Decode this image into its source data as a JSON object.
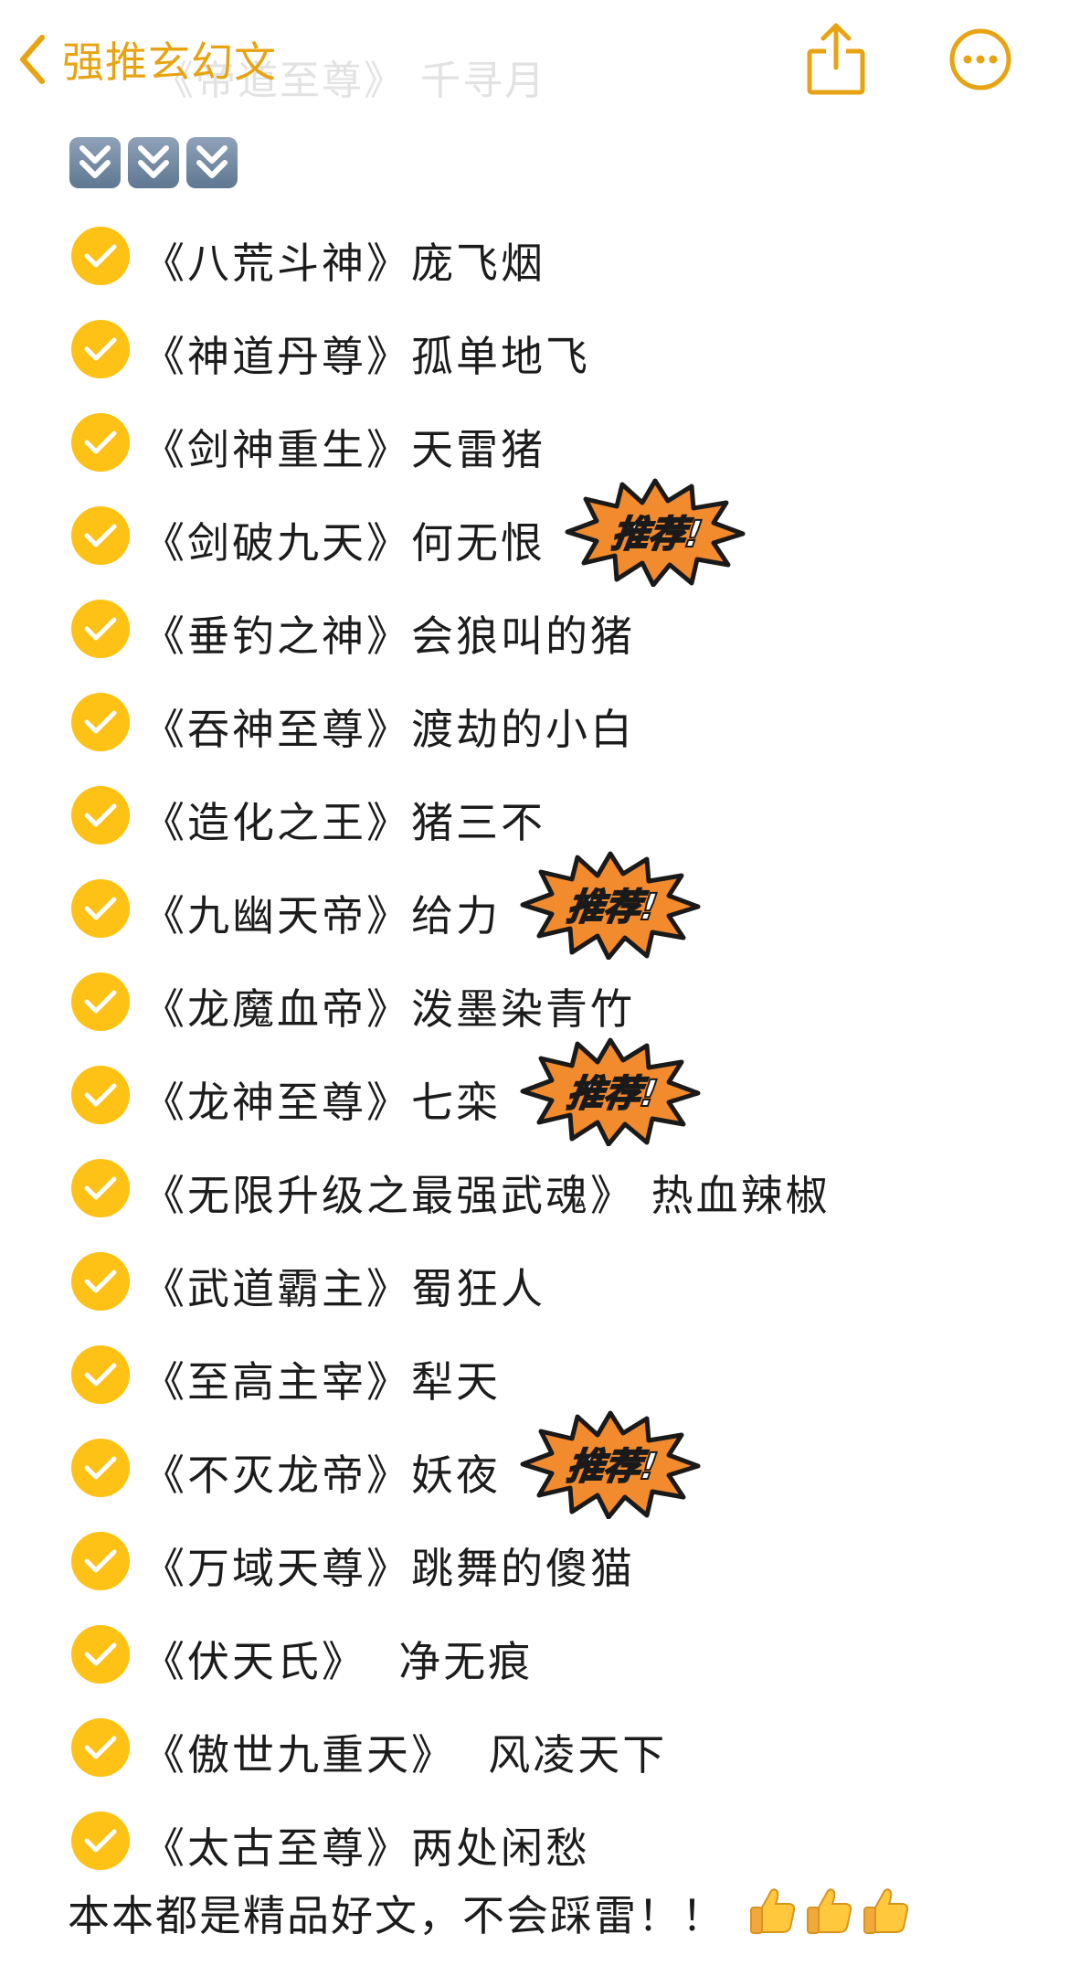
{
  "nav": {
    "back_label": "强推玄幻文",
    "back_icon": "chevron-left-icon",
    "share_icon": "share-icon",
    "more_icon": "more-icon",
    "accent_color": "#E8A312"
  },
  "ghost_text": "《帝道至尊》 千寻月",
  "arrows": [
    "⏬",
    "⏬",
    "⏬"
  ],
  "books": [
    {
      "text": "《八荒斗神》庞飞烟",
      "recommended": false
    },
    {
      "text": "《神道丹尊》孤单地飞",
      "recommended": false
    },
    {
      "text": "《剑神重生》天雷猪",
      "recommended": false
    },
    {
      "text": "《剑破九天》何无恨",
      "recommended": true
    },
    {
      "text": "《垂钓之神》会狼叫的猪",
      "recommended": false
    },
    {
      "text": "《吞神至尊》渡劫的小白",
      "recommended": false
    },
    {
      "text": "《造化之王》猪三不",
      "recommended": false
    },
    {
      "text": "《九幽天帝》给力",
      "recommended": true
    },
    {
      "text": "《龙魔血帝》泼墨染青竹",
      "recommended": false
    },
    {
      "text": "《龙神至尊》七栾",
      "recommended": true
    },
    {
      "text": "《无限升级之最强武魂》 热血辣椒",
      "recommended": false
    },
    {
      "text": "《武道霸主》蜀狂人",
      "recommended": false
    },
    {
      "text": "《至高主宰》犁天",
      "recommended": false
    },
    {
      "text": "《不灭龙帝》妖夜",
      "recommended": true
    },
    {
      "text": "《万域天尊》跳舞的傻猫",
      "recommended": false
    },
    {
      "text": "《伏天氏》  净无痕",
      "recommended": false
    },
    {
      "text": "《傲世九重天》  风凌天下",
      "recommended": false
    },
    {
      "text": "《太古至尊》两处闲愁",
      "recommended": false
    }
  ],
  "badge_label": "推荐!",
  "footer": {
    "text": "本本都是精品好文，不会踩雷！！",
    "emoji": [
      "👍",
      "👍",
      "👍"
    ]
  },
  "colors": {
    "check": "#FDC215",
    "badge_fill": "#F28A2E"
  }
}
